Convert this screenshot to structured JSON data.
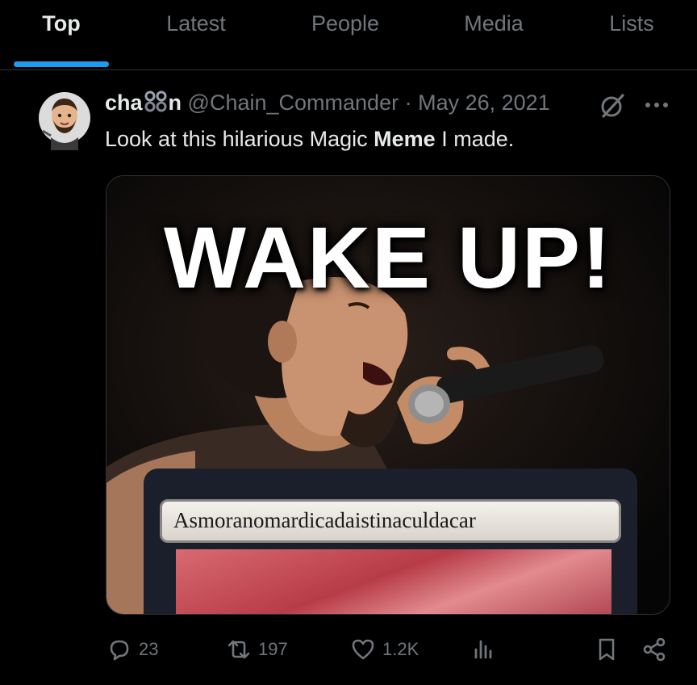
{
  "tabs": [
    {
      "label": "Top",
      "active": true
    },
    {
      "label": "Latest",
      "active": false
    },
    {
      "label": "People",
      "active": false
    },
    {
      "label": "Media",
      "active": false
    },
    {
      "label": "Lists",
      "active": false
    }
  ],
  "tweet": {
    "display_name_prefix": "cha",
    "display_name_suffix": "n",
    "handle": "@Chain_Commander",
    "separator": "·",
    "date": "May 26, 2021",
    "text_before": "Look at this hilarious Magic ",
    "text_bold": "Meme",
    "text_after": " I made.",
    "media": {
      "caption": "WAKE UP!",
      "card_name": "Asmoranomardicadaistinaculdacar"
    },
    "actions": {
      "replies": "23",
      "reposts": "197",
      "likes": "1.2K"
    }
  },
  "colors": {
    "accent": "#1d9bf0",
    "text_primary": "#e7e9ea",
    "text_secondary": "#71767b",
    "background": "#000000"
  },
  "icons": [
    "chain-emoji-icon",
    "grok-icon",
    "more-icon",
    "reply-icon",
    "repost-icon",
    "like-icon",
    "views-icon",
    "bookmark-icon",
    "share-icon"
  ]
}
